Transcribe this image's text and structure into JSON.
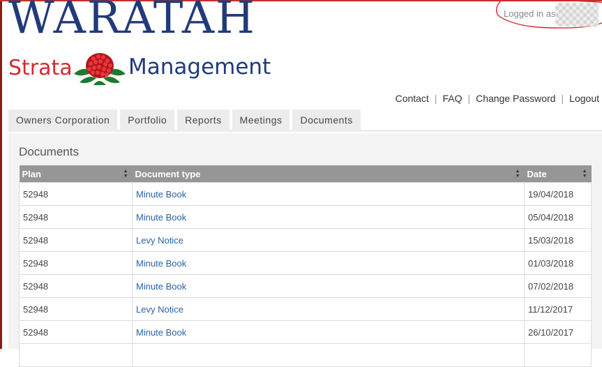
{
  "logo": {
    "big": "WARATAH",
    "left": "Strata",
    "right": "Management"
  },
  "login": {
    "text": "Logged in as"
  },
  "top_links": [
    "Contact",
    "FAQ",
    "Change Password",
    "Logout"
  ],
  "tabs": [
    "Owners Corporation",
    "Portfolio",
    "Reports",
    "Meetings",
    "Documents"
  ],
  "panel": {
    "title": "Documents"
  },
  "table": {
    "headers": [
      "Plan",
      "Document type",
      "Date"
    ],
    "rows": [
      {
        "plan": "52948",
        "type": "Minute Book",
        "date": "19/04/2018"
      },
      {
        "plan": "52948",
        "type": "Minute Book",
        "date": "05/04/2018"
      },
      {
        "plan": "52948",
        "type": "Levy Notice",
        "date": "15/03/2018"
      },
      {
        "plan": "52948",
        "type": "Minute Book",
        "date": "01/03/2018"
      },
      {
        "plan": "52948",
        "type": "Minute Book",
        "date": "07/02/2018"
      },
      {
        "plan": "52948",
        "type": "Levy Notice",
        "date": "11/12/2017"
      },
      {
        "plan": "52948",
        "type": "Minute Book",
        "date": "26/10/2017"
      },
      {
        "plan": "",
        "type": "",
        "date": ""
      }
    ]
  },
  "colors": {
    "brand_blue": "#213a7a",
    "brand_red": "#d62a2f",
    "link": "#2a63a7",
    "header_bg": "#969696"
  }
}
